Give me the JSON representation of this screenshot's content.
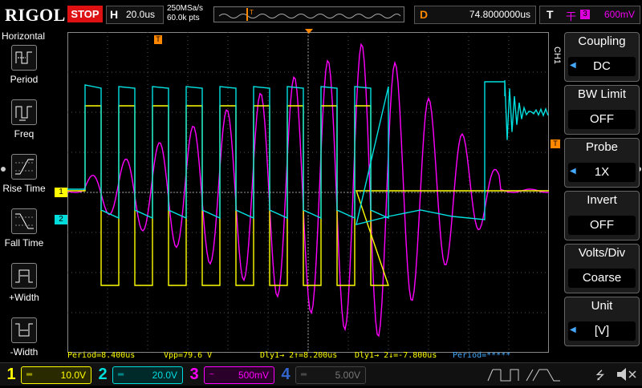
{
  "brand": "RIGOL",
  "run_state": "STOP",
  "horizontal": {
    "label": "H",
    "timebase": "20.0us",
    "sample_rate": "250MSa/s",
    "points": "60.0k pts"
  },
  "delay": {
    "label": "D",
    "value": "74.8000000us"
  },
  "trigger": {
    "label": "T",
    "edge_icon": "rising-edge-icon",
    "source": "3",
    "level": "600mV"
  },
  "left_menu": {
    "title": "Horizontal",
    "items": [
      {
        "label": "Period",
        "icon": "period-icon"
      },
      {
        "label": "Freq",
        "icon": "frequency-icon"
      },
      {
        "label": "Rise Time",
        "icon": "rise-time-icon"
      },
      {
        "label": "Fall Time",
        "icon": "fall-time-icon"
      },
      {
        "label": "+Width",
        "icon": "positive-width-icon"
      },
      {
        "label": "-Width",
        "icon": "negative-width-icon"
      }
    ]
  },
  "right_menu": {
    "channel_tag": "CH1",
    "items": [
      {
        "title": "Coupling",
        "value": "DC",
        "has_arrow": true
      },
      {
        "title": "BW Limit",
        "value": "OFF",
        "has_arrow": false
      },
      {
        "title": "Probe",
        "value": "1X",
        "has_arrow": true
      },
      {
        "title": "Invert",
        "value": "OFF",
        "has_arrow": false
      },
      {
        "title": "Volts/Div",
        "value": "Coarse",
        "has_arrow": false
      },
      {
        "title": "Unit",
        "value": "[V]",
        "has_arrow": true
      }
    ]
  },
  "measurements": {
    "period": "Period=8.400us",
    "vpp": "Vpp=79.6 V",
    "dly_rise": "Dly1→ 2↑=8.200us",
    "dly_fall": "Dly1→ 2↓=-7.800us",
    "period2": "Period=*****"
  },
  "channels": [
    {
      "num": "1",
      "coupling": "═",
      "scale": "10.0V",
      "color": "#ffff00",
      "active": true
    },
    {
      "num": "2",
      "coupling": "═",
      "scale": "20.0V",
      "color": "#00e0e0",
      "active": true
    },
    {
      "num": "3",
      "coupling": "~",
      "scale": "500mV",
      "color": "#ff00ff",
      "active": true
    },
    {
      "num": "4",
      "coupling": "═",
      "scale": "5.00V",
      "color": "#2060ff",
      "active": false
    }
  ],
  "markers": {
    "ch1": "1",
    "ch2": "2",
    "trigger": "T"
  },
  "colors": {
    "ch1": "#ffff00",
    "ch2": "#00e0e0",
    "ch3": "#ff00ff",
    "ch4": "#2060ff",
    "trigger": "#ff8800",
    "grid": "#555555"
  }
}
